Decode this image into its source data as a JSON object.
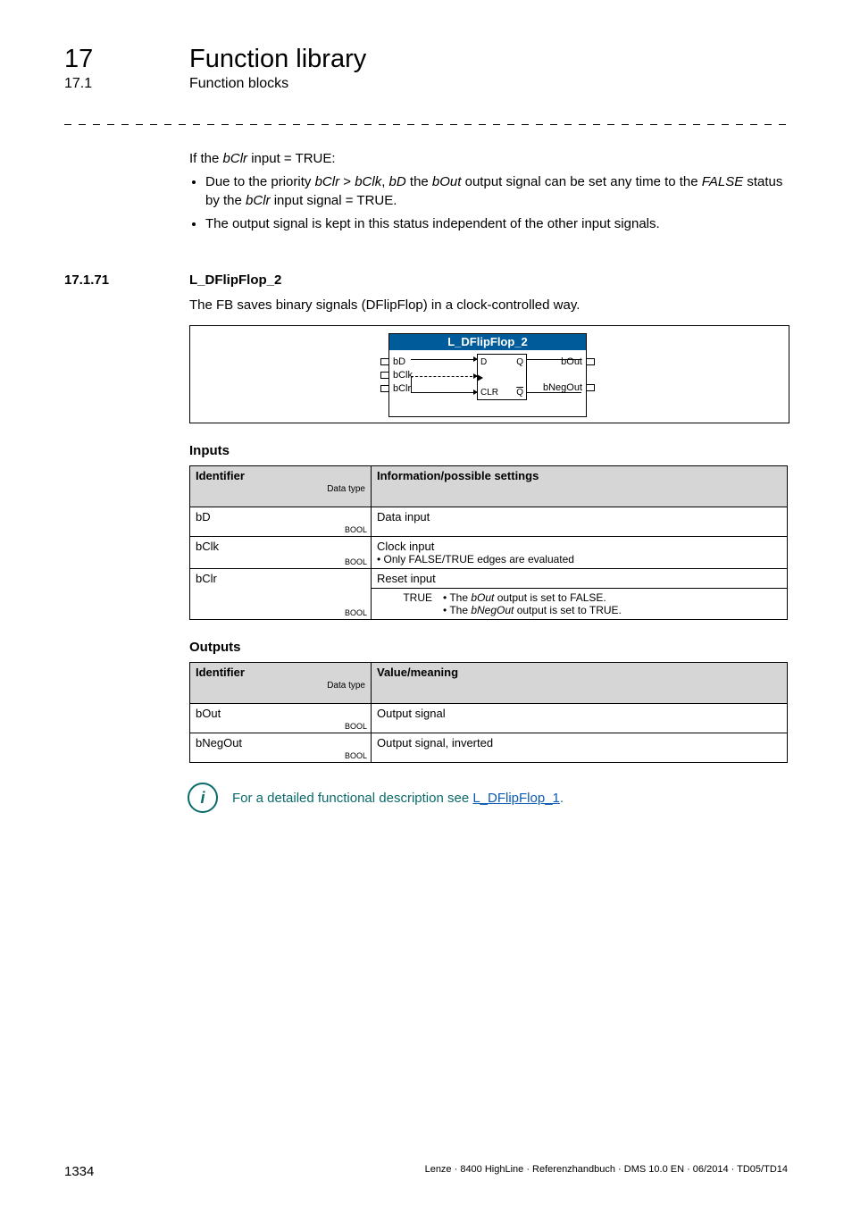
{
  "chapter": {
    "num": "17",
    "title": "Function library"
  },
  "sub": {
    "num": "17.1",
    "title": "Function blocks"
  },
  "intro": {
    "line": "If the bClr input = TRUE:",
    "bullets": [
      "Due to the priority bClr > bClk, bD the bOut output signal can be set any time to the FALSE status by the bClr input signal = TRUE.",
      "The output signal is kept in this status independent of the other input signals."
    ]
  },
  "section": {
    "num": "17.1.71",
    "title": "L_DFlipFlop_2",
    "desc": "The FB saves binary signals (DFlipFlop) in a clock-controlled way."
  },
  "diagram": {
    "title": "L_DFlipFlop_2",
    "inputs": [
      "bD",
      "bClk",
      "bClr"
    ],
    "outputs": [
      "bOut",
      "bNegOut"
    ],
    "inner": {
      "d": "D",
      "q": "Q",
      "clr": "CLR",
      "qb": "Q"
    }
  },
  "inputs": {
    "heading": "Inputs",
    "header_id": "Identifier",
    "header_dt": "Data type",
    "header_info": "Information/possible settings",
    "rows": [
      {
        "id": "bD",
        "dtype": "BOOL",
        "info": "Data input"
      },
      {
        "id": "bClk",
        "dtype": "BOOL",
        "info": "Clock input",
        "sub": "• Only FALSE/TRUE edges are evaluated"
      },
      {
        "id": "bClr",
        "dtype": "BOOL",
        "info": "Reset input",
        "nested": {
          "key": "TRUE",
          "lines": [
            "• The bOut output is set to FALSE.",
            "• The bNegOut output is set to TRUE."
          ]
        }
      }
    ]
  },
  "outputs": {
    "heading": "Outputs",
    "header_id": "Identifier",
    "header_dt": "Data type",
    "header_info": "Value/meaning",
    "rows": [
      {
        "id": "bOut",
        "dtype": "BOOL",
        "info": "Output signal"
      },
      {
        "id": "bNegOut",
        "dtype": "BOOL",
        "info": "Output signal, inverted"
      }
    ]
  },
  "tip": {
    "prefix": "For a detailed functional description see ",
    "link": "L_DFlipFlop_1",
    "suffix": "."
  },
  "footer": {
    "page": "1334",
    "meta": "Lenze · 8400 HighLine · Referenzhandbuch · DMS 10.0 EN · 06/2014 · TD05/TD14"
  }
}
